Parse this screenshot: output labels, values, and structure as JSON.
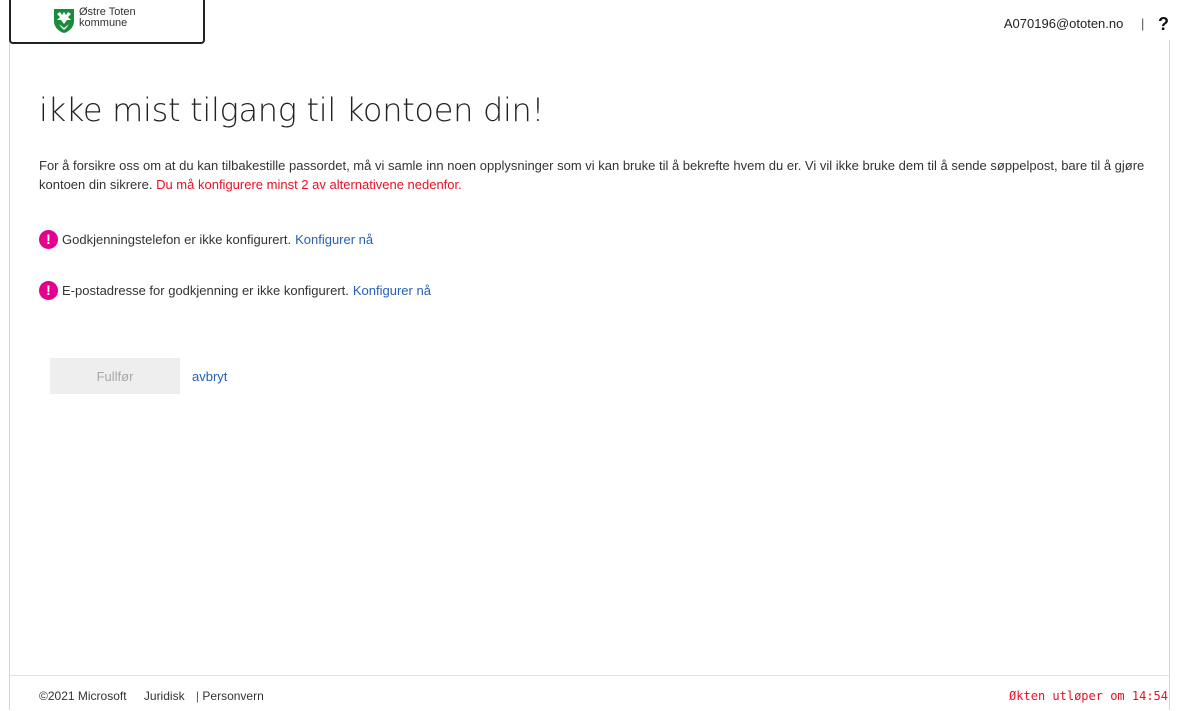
{
  "header": {
    "logo_line1": "Østre Toten",
    "logo_line2": "kommune",
    "user_email": "A070196@ototen.no",
    "separator": "|",
    "help_label": "?"
  },
  "main": {
    "title": "ikke mist tilgang til kontoen din!",
    "intro": "For å forsikre oss om at du kan tilbakestille passordet, må vi samle inn noen opplysninger som vi kan bruke til å bekrefte hvem du er. Vi vil ikke bruke dem til å sende søppelpost, bare til å gjøre kontoen din sikrere.",
    "intro_required": "Du må konfigurere minst 2 av alternativene nedenfor.",
    "items": [
      {
        "icon": "exclamation-circle-icon",
        "status": "Godkjenningstelefon er ikke konfigurert.",
        "link": "Konfigurer nå"
      },
      {
        "icon": "exclamation-circle-icon",
        "status": "E-postadresse for godkjenning er ikke konfigurert.",
        "link": "Konfigurer nå"
      }
    ],
    "finish_label": "Fullfør",
    "cancel_label": "avbryt"
  },
  "footer": {
    "copyright": "©2021 Microsoft",
    "legal": "Juridisk",
    "separator": "|",
    "privacy": "Personvern",
    "session": "Økten utløper om 14:54"
  },
  "colors": {
    "warning": "#e3008c",
    "link": "#2461b5",
    "required": "#e81123",
    "logo_green": "#1a8a3c"
  }
}
